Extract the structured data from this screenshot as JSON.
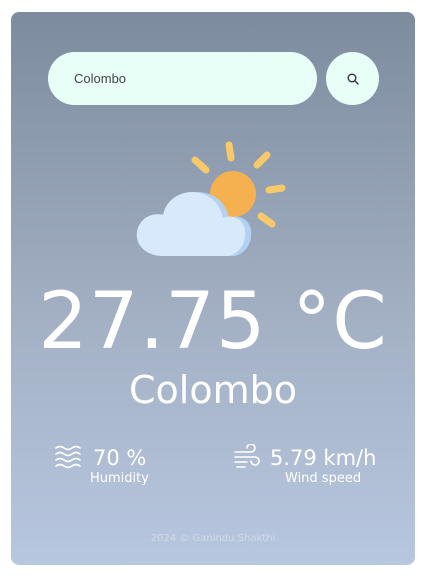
{
  "search": {
    "value": "Colombo",
    "button_icon": "search-icon"
  },
  "weather": {
    "condition_icon": "partly-cloudy-icon",
    "temperature": "27.75 °C",
    "city": "Colombo"
  },
  "details": {
    "humidity": {
      "icon": "humidity-icon",
      "value": "70 %",
      "label": "Humidity"
    },
    "wind": {
      "icon": "wind-icon",
      "value": "5.79 km/h",
      "label": "Wind speed"
    }
  },
  "footer": {
    "text": "2024 © Ganindu Shakthi"
  },
  "colors": {
    "card_top": "#7d8b9e",
    "card_bottom": "#b7c7df",
    "input_bg": "#e8fff8",
    "sun": "#f5b04f",
    "sun_rays": "#f7c96a",
    "cloud": "#d8e9fb",
    "cloud_shadow": "#b3d1f2"
  }
}
